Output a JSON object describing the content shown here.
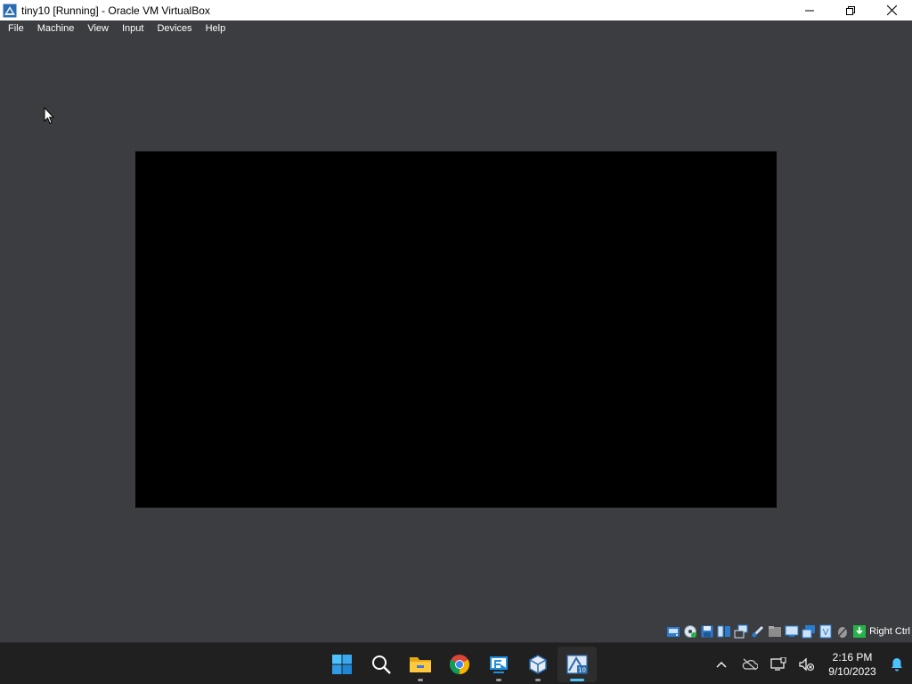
{
  "window": {
    "title": "tiny10 [Running] - Oracle VM VirtualBox",
    "controls": [
      "minimize-icon",
      "restore-icon",
      "close-icon"
    ]
  },
  "menu": [
    {
      "label": "File"
    },
    {
      "label": "Machine"
    },
    {
      "label": "View"
    },
    {
      "label": "Input"
    },
    {
      "label": "Devices"
    },
    {
      "label": "Help"
    }
  ],
  "guest": {
    "screen_color": "#000000"
  },
  "statusbar": {
    "icons": [
      "hard-disk-icon",
      "optical-drive-icon",
      "floppy-icon",
      "audio-icon",
      "network-icon",
      "usb-icon",
      "shared-folders-icon",
      "display-icon",
      "recording-icon",
      "vt-x-icon",
      "mouse-integration-icon",
      "keyboard-icon"
    ],
    "host_key": "Right Ctrl"
  },
  "taskbar": {
    "apps": [
      "start-icon",
      "search-icon",
      "file-explorer-icon",
      "chrome-icon",
      "remote-desktop-icon",
      "virtualbox-icon",
      "tiny10-vm-icon"
    ],
    "clock": {
      "time": "2:16 PM",
      "date": "9/10/2023"
    },
    "tray": [
      "chevron-up-icon",
      "onedrive-icon",
      "network-tray-icon",
      "volume-muted-icon",
      "notification-bell-icon"
    ]
  },
  "colors": {
    "background": "#3c3d40",
    "titlebar": "#ffffff",
    "taskbar": "#202020",
    "accent": "#4cc2ff"
  }
}
